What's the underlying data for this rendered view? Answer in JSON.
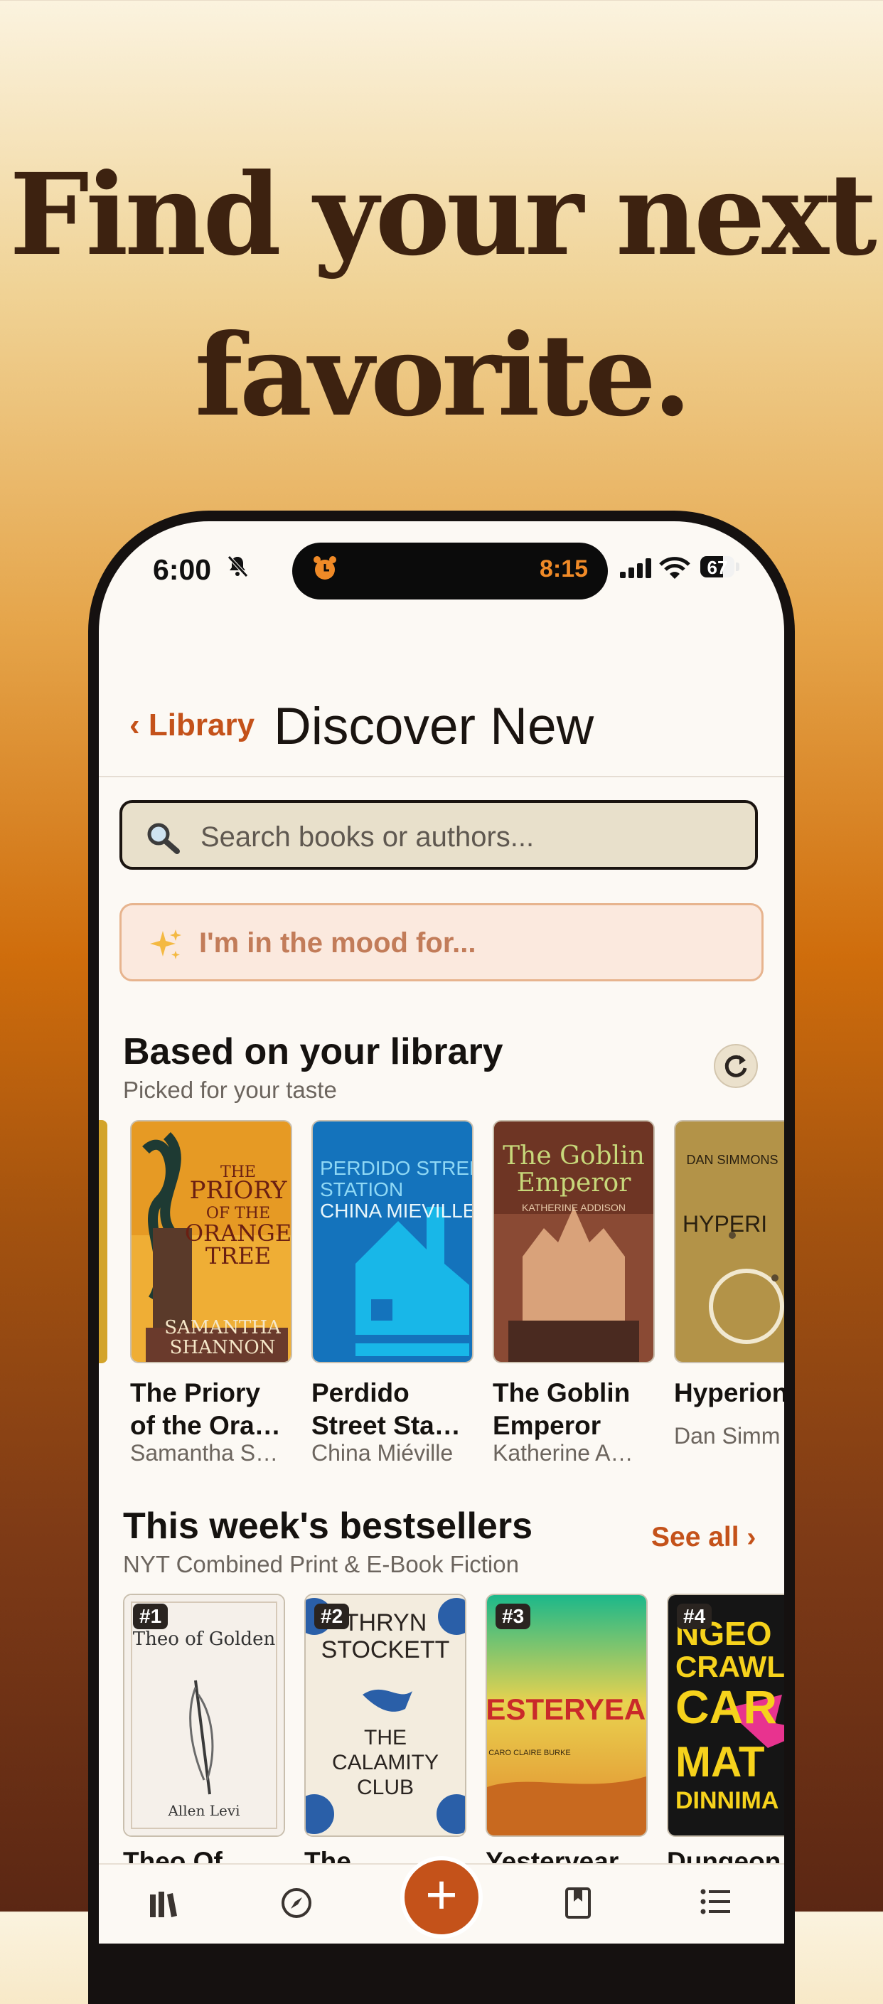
{
  "headline": {
    "line1": "Find your next",
    "line2": "favorite."
  },
  "status_bar": {
    "time": "6:00",
    "island_time": "8:15",
    "battery": "67",
    "battery_level": 0.67,
    "icons": [
      "bell-slash-icon",
      "alarm-clock-icon",
      "cellular-signal-icon",
      "wifi-icon",
      "battery-icon"
    ]
  },
  "nav": {
    "back_label": "‹ Library",
    "title": "Discover New"
  },
  "search": {
    "placeholder": "Search books or authors...",
    "icon": "magnifier-icon"
  },
  "mood": {
    "label": "I'm in the mood for...",
    "icon": "sparkles-icon"
  },
  "library_section": {
    "title": "Based on your library",
    "subtitle": "Picked for your taste",
    "refresh_icon": "refresh-icon",
    "books": [
      {
        "title_line1": "The Priory",
        "title_line2": "of the Ora…",
        "author": "Samantha S…",
        "cover": {
          "line1": "THE",
          "line2": "PRIORY",
          "line3": "OF THE",
          "line4": "ORANGE",
          "line5": "TREE",
          "author_line1": "SAMANTHA",
          "author_line2": "SHANNON"
        }
      },
      {
        "title_line1": "Perdido",
        "title_line2": "Street Sta…",
        "author": "China Miéville",
        "cover": {
          "line1": "PERDIDO STREET",
          "line2": "STATION",
          "line3": "CHINA MIEVILLE"
        }
      },
      {
        "title_line1": "The Goblin",
        "title_line2": "Emperor",
        "author": "Katherine A…",
        "cover": {
          "line1": "The Goblin",
          "line2": "Emperor",
          "author": "KATHERINE ADDISON"
        }
      },
      {
        "title_line1": "Hyperion",
        "title_line2": "",
        "author": "Dan Simm",
        "cover": {
          "author": "DAN SIMMONS",
          "title": "HYPERI"
        }
      }
    ]
  },
  "bestsellers_section": {
    "title": "This week's bestsellers",
    "subtitle": "NYT Combined Print & E-Book Fiction",
    "see_all": "See all ›",
    "books": [
      {
        "rank": "#1",
        "title": "Theo Of",
        "cover": {
          "line1": "Theo of Golden",
          "author": "Allen Levi"
        }
      },
      {
        "rank": "#2",
        "title": "The",
        "cover": {
          "line1": "THRYN",
          "line2": "STOCKETT",
          "line3": "THE",
          "line4": "CALAMITY",
          "line5": "CLUB"
        }
      },
      {
        "rank": "#3",
        "title": "Yesteryear",
        "cover": {
          "line1": "YESTERYEAR",
          "author": "CARO CLAIRE BURKE"
        }
      },
      {
        "rank": "#4",
        "title": "Dungeon",
        "cover": {
          "line1": "NGEO",
          "line2": "CRAWL",
          "line3": "CAR",
          "line4": "MAT",
          "line5": "DINNIMA"
        }
      }
    ]
  },
  "tab_bar": {
    "icons": [
      "library-icon",
      "compass-icon",
      "add-icon",
      "bookmark-icon",
      "list-icon"
    ]
  }
}
